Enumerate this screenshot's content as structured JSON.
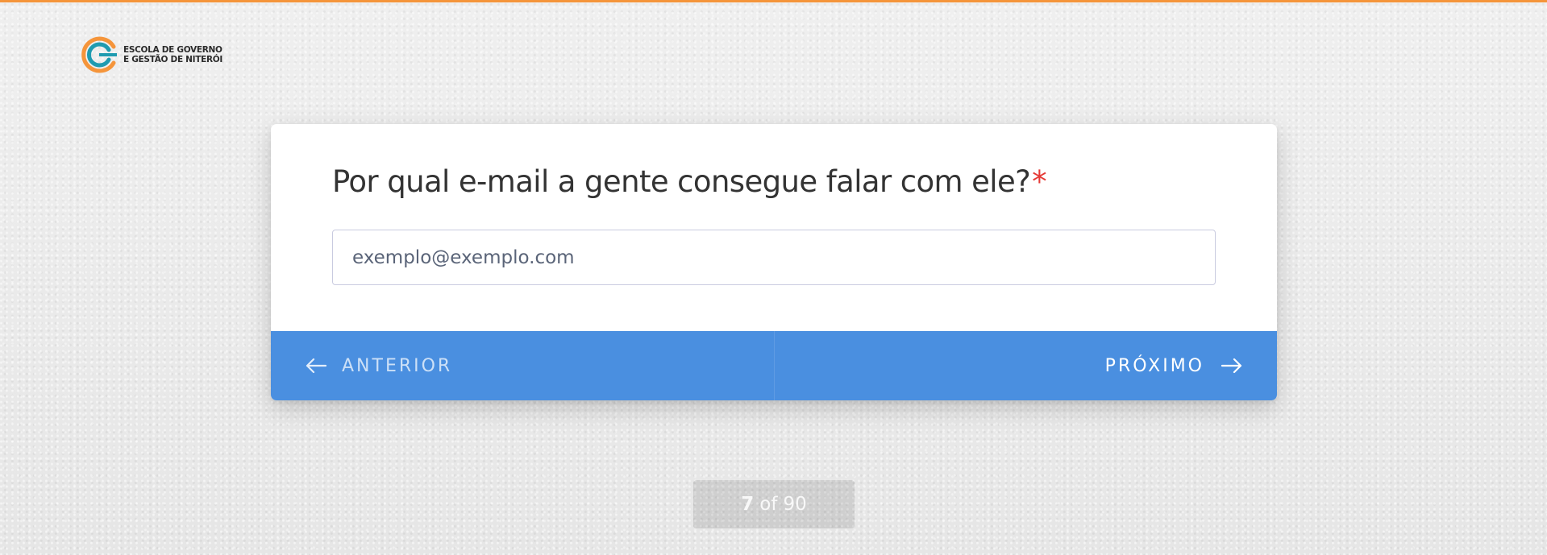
{
  "brand": {
    "logo_line1": "ESCOLA DE GOVERNO",
    "logo_line2": "E GESTÃO DE NITERÓI",
    "accent_color": "#f5953b",
    "teal_color": "#1f9bb0"
  },
  "question": {
    "text": "Por qual e-mail a gente consegue falar com ele?",
    "required_marker": "*"
  },
  "email_field": {
    "placeholder": "exemplo@exemplo.com",
    "value": ""
  },
  "navigation": {
    "prev_label": "ANTERIOR",
    "next_label": "PRÓXIMO",
    "bar_color": "#4a8fe0"
  },
  "progress": {
    "current": "7",
    "separator": "of",
    "total": "90"
  },
  "icons": {
    "prev": "arrow-left-icon",
    "next": "arrow-right-icon",
    "logo": "egn-logo-icon"
  }
}
